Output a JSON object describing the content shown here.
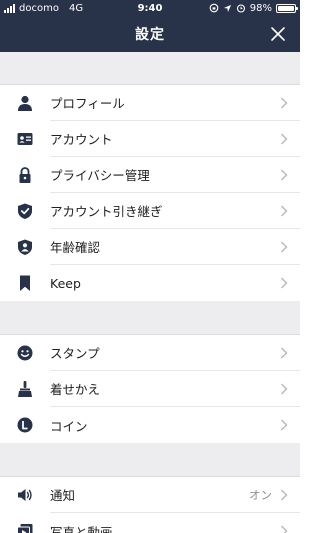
{
  "status_bar": {
    "carrier": "docomo",
    "network": "4G",
    "time": "9:40",
    "battery": "98%",
    "battery_level": 0.98
  },
  "nav": {
    "title": "設定"
  },
  "sections": [
    {
      "rows": [
        {
          "label": "プロフィール",
          "icon": "person-icon"
        },
        {
          "label": "アカウント",
          "icon": "id-card-icon"
        },
        {
          "label": "プライバシー管理",
          "icon": "lock-icon"
        },
        {
          "label": "アカウント引き継ぎ",
          "icon": "shield-check-icon"
        },
        {
          "label": "年齢確認",
          "icon": "shield-person-icon"
        },
        {
          "label": "Keep",
          "icon": "bookmark-icon"
        }
      ]
    },
    {
      "rows": [
        {
          "label": "スタンプ",
          "icon": "smiley-icon"
        },
        {
          "label": "着せかえ",
          "icon": "brush-icon"
        },
        {
          "label": "コイン",
          "icon": "coin-icon"
        }
      ]
    },
    {
      "rows": [
        {
          "label": "通知",
          "icon": "speaker-icon",
          "value": "オン"
        },
        {
          "label": "写真と動画",
          "icon": "video-icon"
        }
      ]
    }
  ],
  "colors": {
    "header_bg": "#283249",
    "icon": "#283249",
    "section_gap": "#ededf0"
  }
}
